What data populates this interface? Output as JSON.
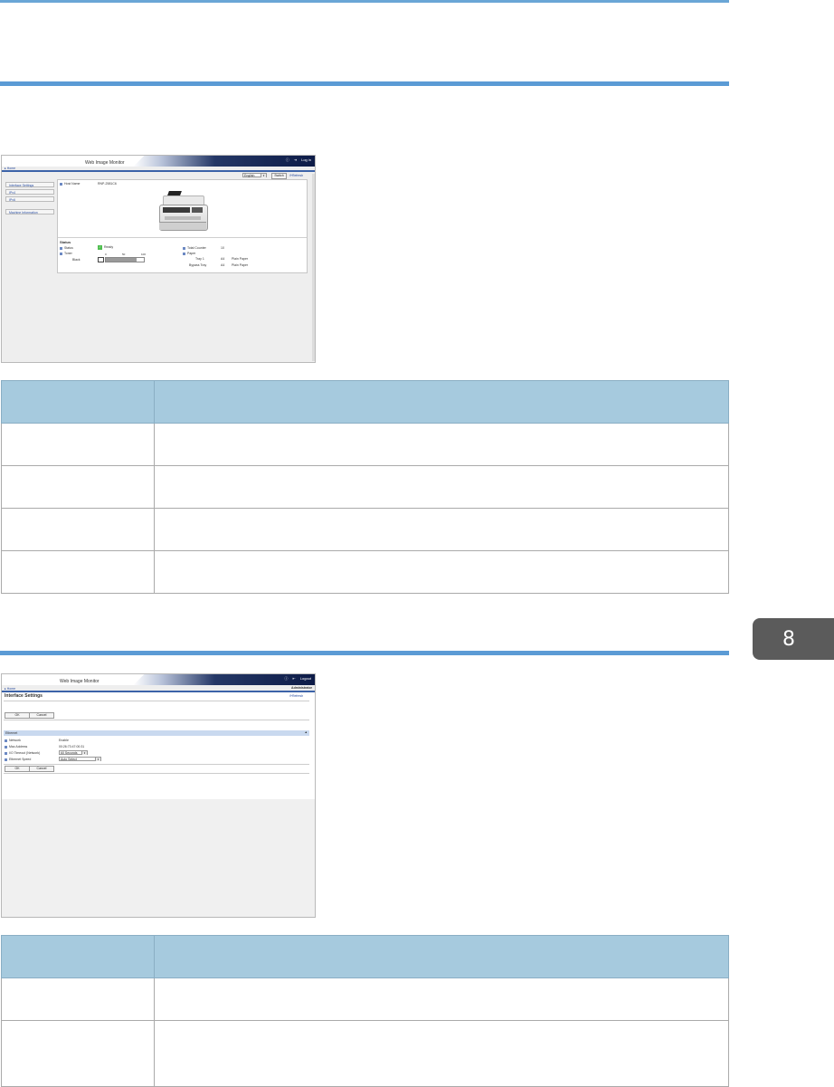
{
  "chapter_tab": "8",
  "screen1": {
    "brand": "Web Image Monitor",
    "header_links": [
      "Log in"
    ],
    "home_link": "▸ Home",
    "language": "English",
    "switch_button": "Switch",
    "refresh": "Refresh",
    "nav_items": [
      "Interface Settings",
      "IPv4",
      "IPv6",
      "Machine Information"
    ],
    "host_name_label": "Host Name",
    "host_name_value": "RNP-2581C6",
    "status_heading": "Status",
    "status_label": "Status",
    "status_value": "Ready",
    "toner_label": "Toner",
    "toner_color": "Black",
    "toner_scale": [
      "0",
      "50",
      "100"
    ],
    "toner_level_percent": 80,
    "total_counter_label": "Total Counter",
    "total_counter_value": "10",
    "paper_label": "Paper",
    "trays": [
      {
        "name": "Tray 1",
        "size": "A4",
        "type": "Plain Paper"
      },
      {
        "name": "Bypass Tray",
        "size": "A4",
        "type": "Plain Paper"
      }
    ]
  },
  "screen2": {
    "brand": "Web Image Monitor",
    "header_links": [
      "Logout"
    ],
    "user": "Administrator",
    "home_link": "▸ Home",
    "title": "Interface Settings",
    "refresh": "Refresh",
    "ok_label": "OK",
    "cancel_label": "Cancel",
    "section": "Ethernet",
    "rows": [
      {
        "label": "Network",
        "value": "Enable"
      },
      {
        "label": "Mac Address",
        "value": "00:26:73:47:00:31"
      },
      {
        "label": "I/O Timeout (Network)",
        "value": "60 Seconds"
      },
      {
        "label": "Ethernet Speed",
        "value": "Auto Select"
      }
    ]
  },
  "table1": {
    "headers": [
      "",
      ""
    ],
    "rows": [
      [
        "",
        ""
      ],
      [
        "",
        ""
      ],
      [
        "",
        ""
      ],
      [
        "",
        ""
      ]
    ]
  },
  "table2": {
    "headers": [
      "",
      ""
    ],
    "rows": [
      [
        "",
        ""
      ],
      [
        "",
        ""
      ]
    ]
  }
}
